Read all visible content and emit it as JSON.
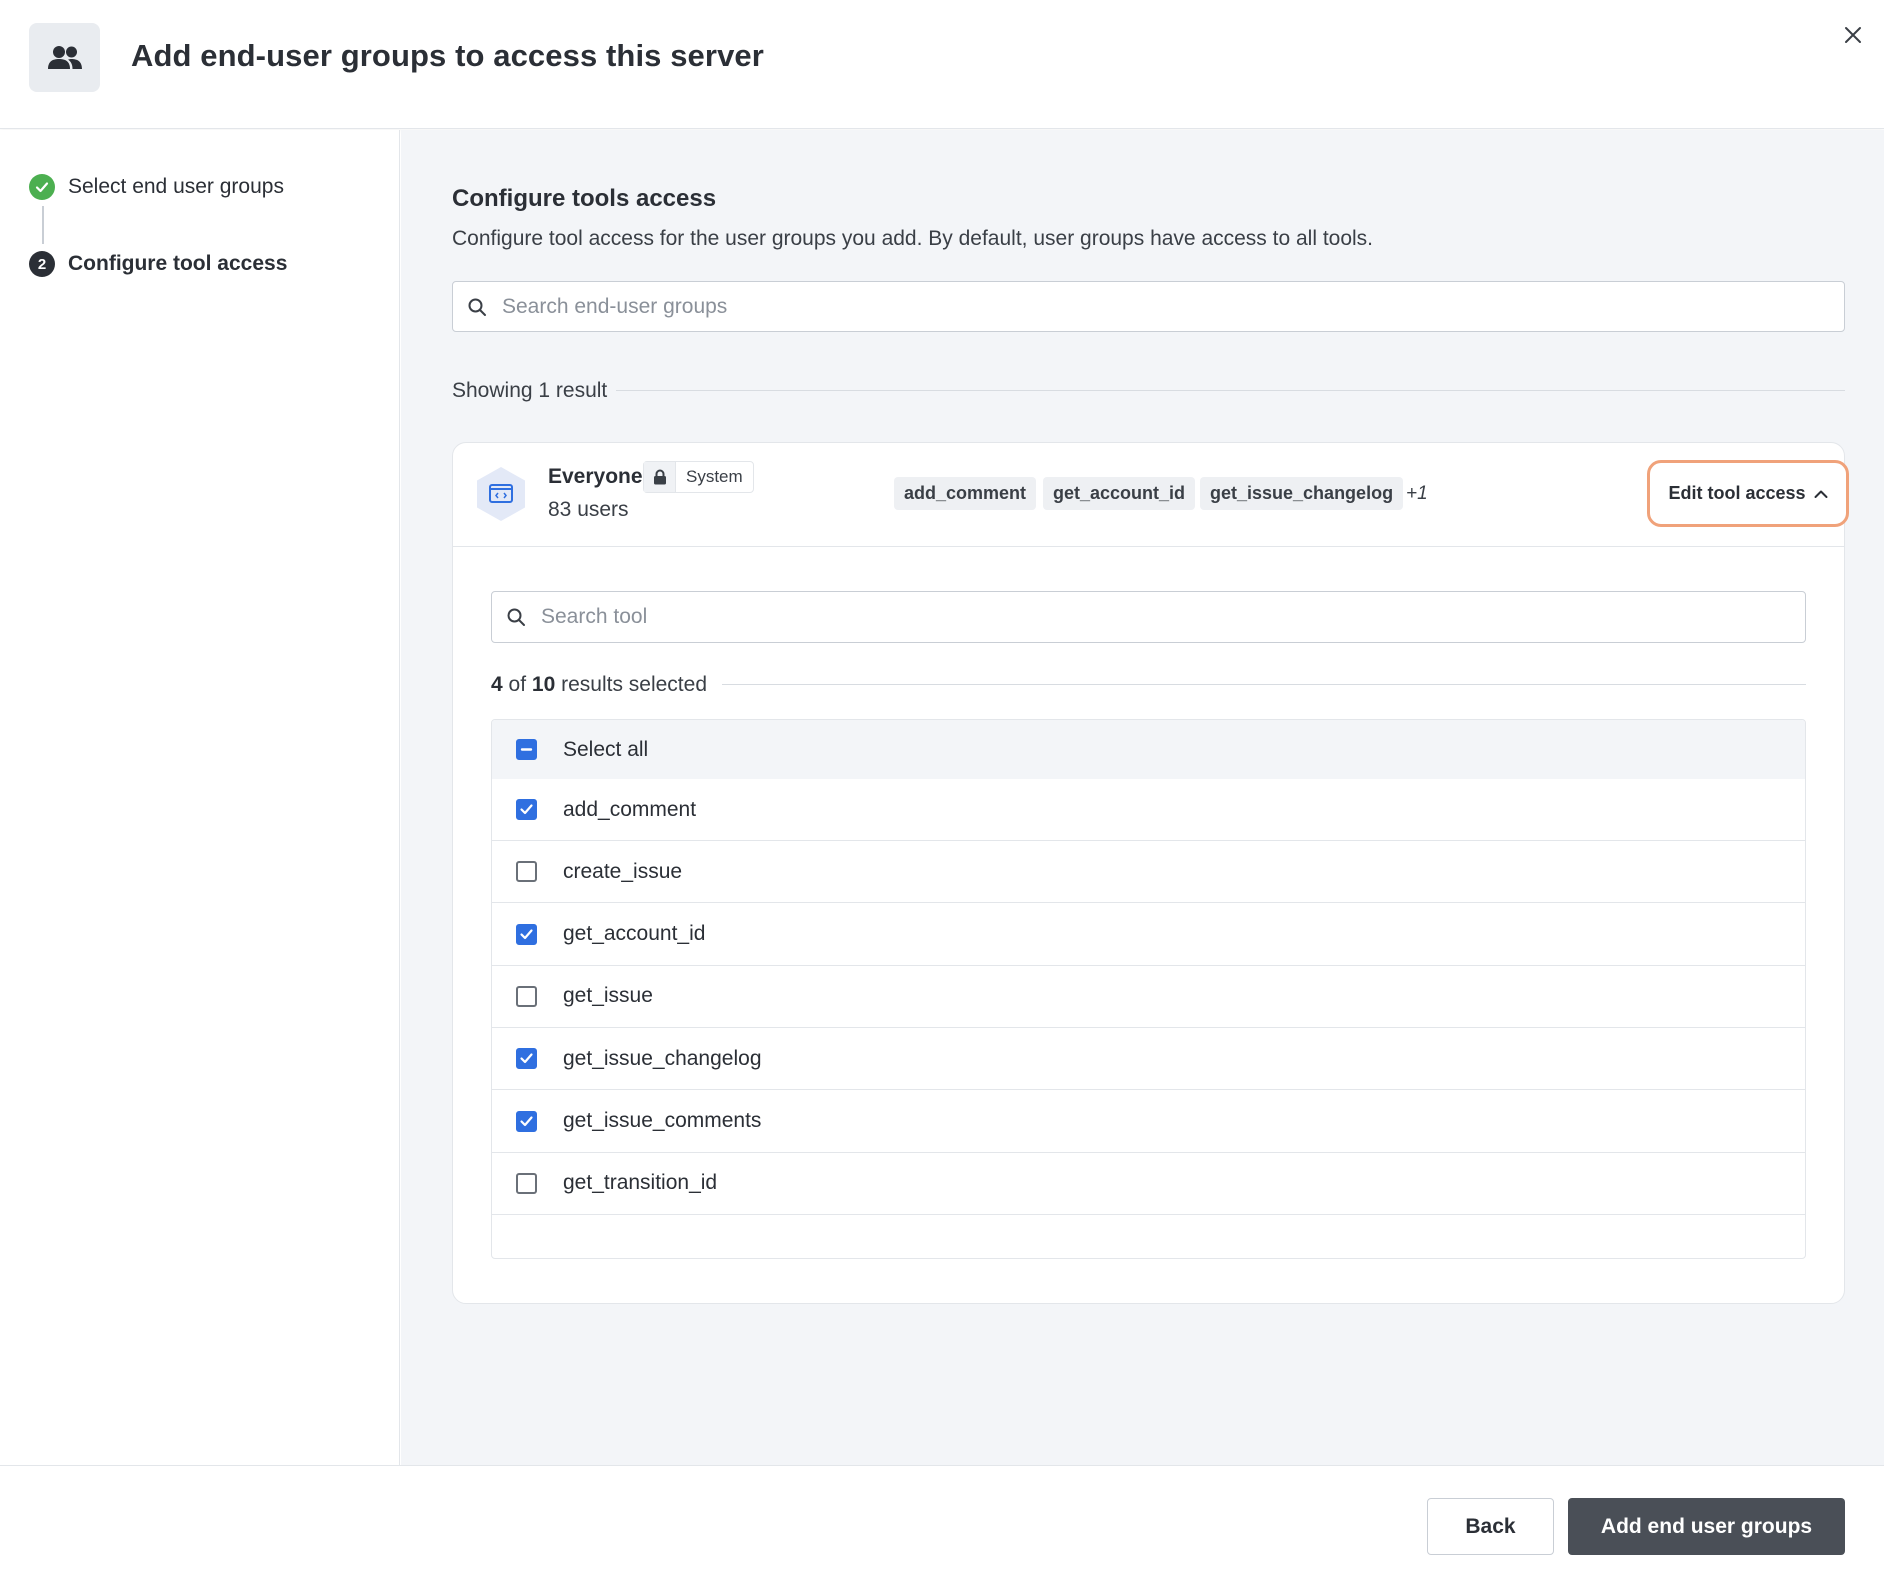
{
  "header": {
    "title": "Add end-user groups to access this server",
    "icon": "users-icon"
  },
  "steps": [
    {
      "label": "Select end user groups",
      "state": "done"
    },
    {
      "number": "2",
      "label": "Configure tool access",
      "state": "current"
    }
  ],
  "main": {
    "title": "Configure tools access",
    "description": "Configure tool access for the user groups you add. By default, user groups have access to all tools.",
    "search_placeholder": "Search end-user groups",
    "showing": "Showing 1 result"
  },
  "group": {
    "name": "Everyone",
    "badge": "System",
    "users": "83 users",
    "tags": [
      "add_comment",
      "get_account_id",
      "get_issue_changelog"
    ],
    "more": "+1",
    "edit_label": "Edit tool access"
  },
  "tools": {
    "search_placeholder": "Search tool",
    "selected_num": "4",
    "selected_of": "of",
    "total_num": "10",
    "selected_suffix": "results selected",
    "select_all_label": "Select all",
    "items": [
      {
        "label": "add_comment",
        "checked": true
      },
      {
        "label": "create_issue",
        "checked": false
      },
      {
        "label": "get_account_id",
        "checked": true
      },
      {
        "label": "get_issue",
        "checked": false
      },
      {
        "label": "get_issue_changelog",
        "checked": true
      },
      {
        "label": "get_issue_comments",
        "checked": true
      },
      {
        "label": "get_transition_id",
        "checked": false
      }
    ]
  },
  "footer": {
    "back_label": "Back",
    "primary_label": "Add end user groups"
  },
  "colors": {
    "accent": "#2f6fe0",
    "success": "#4caf50",
    "highlight": "#f0a27a",
    "primary_button": "#4a4f57"
  }
}
